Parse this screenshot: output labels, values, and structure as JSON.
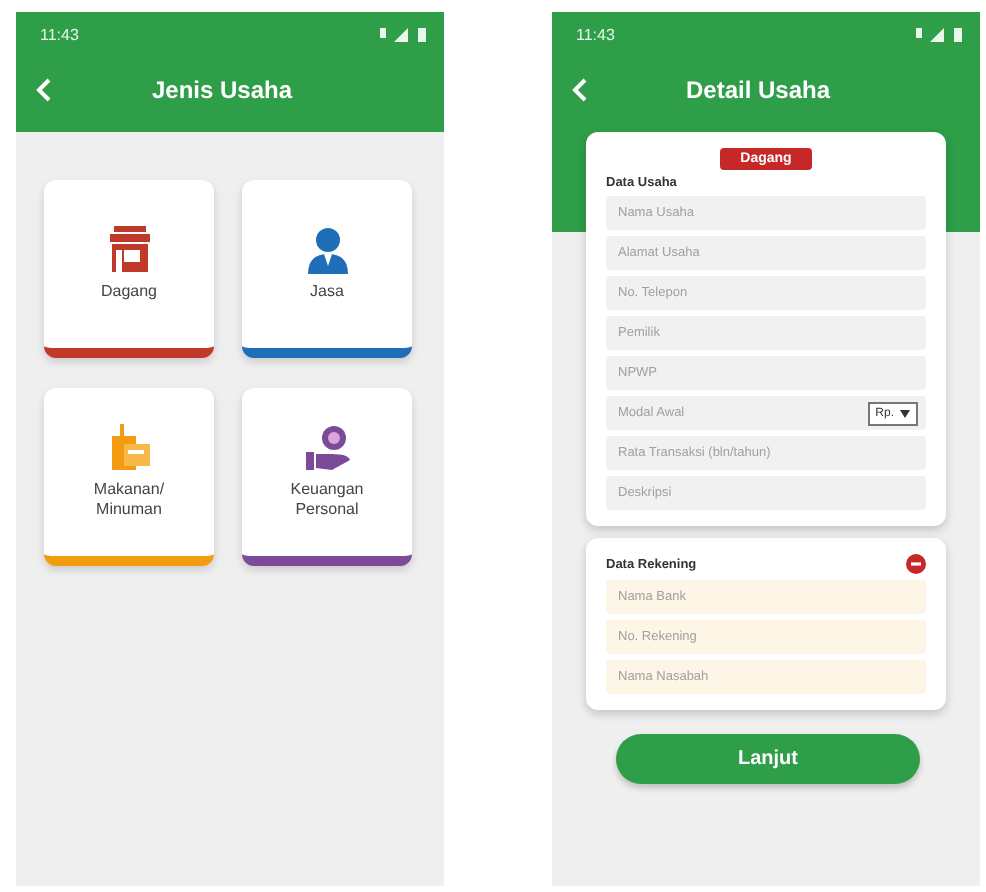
{
  "screens": [
    {
      "kind": "menu",
      "status_time": "11:43",
      "title": "Jenis Usaha",
      "categories": [
        {
          "label": "Dagang",
          "kind": "shop",
          "color": "#c0392b"
        },
        {
          "label": "Jasa",
          "kind": "person",
          "color": "#1f6fb8"
        },
        {
          "label": "Makanan/\nMinuman",
          "kind": "food",
          "color": "#f39c12"
        },
        {
          "label": "Keuangan\nPersonal",
          "kind": "money",
          "color": "#7d4a9a"
        }
      ]
    },
    {
      "kind": "form",
      "status_time": "11:43",
      "title": "Detail Usaha",
      "badge": "Dagang",
      "business_section": {
        "title": "Data Usaha",
        "fields": [
          {
            "placeholder": "Nama Usaha"
          },
          {
            "placeholder": "Alamat Usaha"
          },
          {
            "placeholder": "No. Telepon"
          },
          {
            "placeholder": "Pemilik"
          },
          {
            "placeholder": "NPWP"
          },
          {
            "placeholder": "Modal Awal",
            "unit": "Rp."
          },
          {
            "placeholder": "Rata Transaksi (bln/tahun)"
          },
          {
            "placeholder": "Deskripsi"
          }
        ]
      },
      "bank_section": {
        "title": "Data Rekening",
        "fields": [
          {
            "placeholder": "Nama Bank"
          },
          {
            "placeholder": "No. Rekening"
          },
          {
            "placeholder": "Nama Nasabah"
          }
        ]
      },
      "submit": "Lanjut"
    }
  ]
}
